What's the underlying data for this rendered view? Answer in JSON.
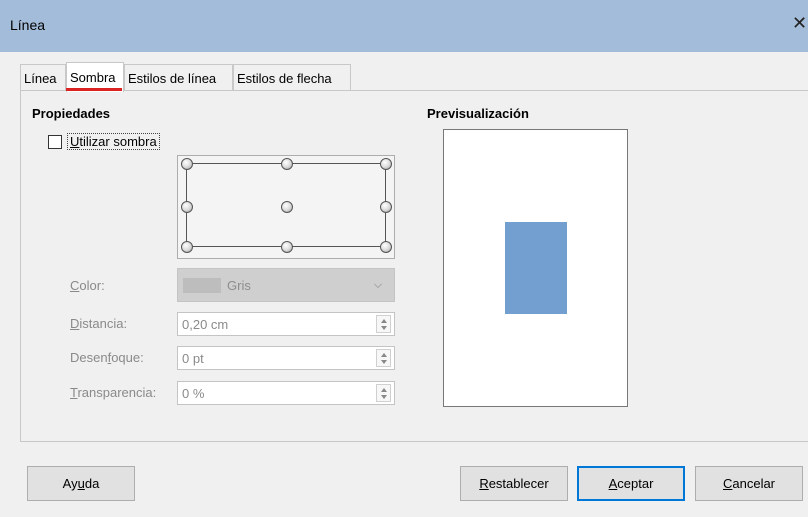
{
  "window": {
    "title": "Línea",
    "close_icon": "close-icon"
  },
  "tabs": [
    {
      "label": "Línea",
      "active": false
    },
    {
      "label": "Sombra",
      "active": true
    },
    {
      "label": "Estilos de línea",
      "active": false
    },
    {
      "label": "Estilos de flecha",
      "active": false
    }
  ],
  "properties": {
    "heading": "Propiedades",
    "use_shadow_label": "Utilizar sombra",
    "use_shadow_checked": false,
    "color": {
      "label": "Color:",
      "value": "Gris",
      "swatch": "#bdbdbd"
    },
    "distance": {
      "label": "Distancia:",
      "value": "0,20 cm"
    },
    "blur": {
      "label": "Desenfoque:",
      "value": "0 pt"
    },
    "transparency": {
      "label": "Transparencia:",
      "value": "0 %"
    }
  },
  "preview": {
    "heading": "Previsualización",
    "shape_color": "#729fcf"
  },
  "buttons": {
    "help": "Ayuda",
    "reset": "Restablecer",
    "ok": "Aceptar",
    "cancel": "Cancelar"
  },
  "colors": {
    "titlebar": "#a3bcd9",
    "accent": "#0078d7",
    "tab_indicator": "#dd2222"
  }
}
